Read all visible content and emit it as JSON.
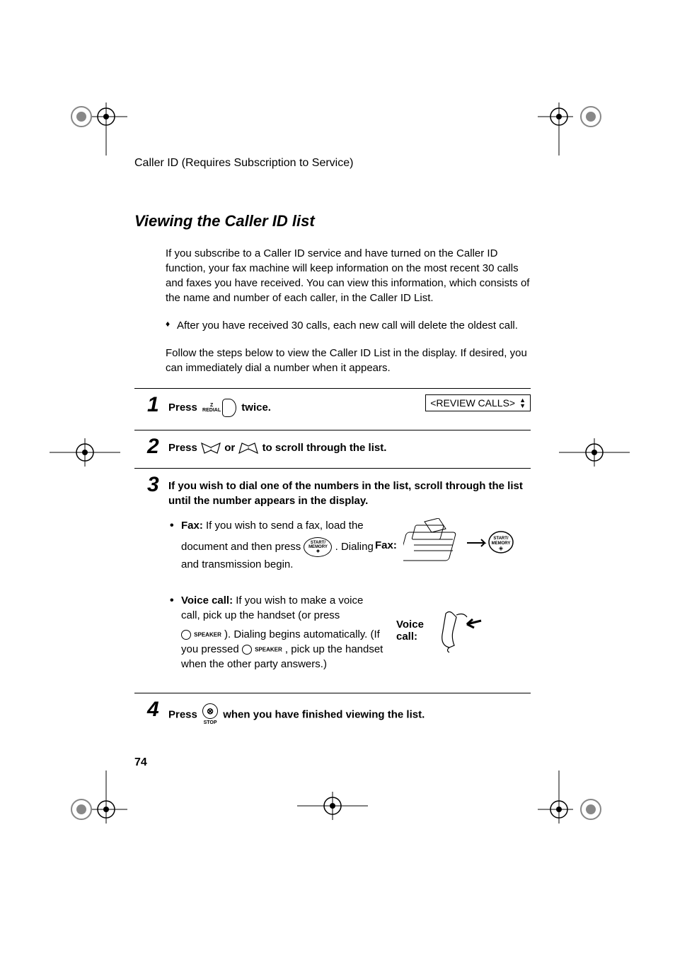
{
  "header": "Caller ID (Requires Subscription to Service)",
  "section_title": "Viewing the Caller ID list",
  "intro": "If you subscribe to a Caller ID service and have turned on the Caller ID function, your fax machine will keep information on the most recent 30 calls and faxes you have received. You can view this information, which consists of the name and number of each caller, in the Caller ID List.",
  "bullet": "After you have received 30 calls, each new call will delete the oldest call.",
  "follow": "Follow the steps below to view the Caller ID List in the display. If desired, you can immediately dial a number when it appears.",
  "display_text": "<REVIEW CALLS>",
  "steps": {
    "s1": {
      "num": "1",
      "press": "Press",
      "twice": " twice."
    },
    "s2": {
      "num": "2",
      "press": "Press ",
      "or": " or ",
      "tail": "  to  scroll through the list."
    },
    "s3": {
      "num": "3",
      "head": "If you wish to dial one of the numbers in the list, scroll through the list until the number appears in the display.",
      "fax_label": "Fax:",
      "fax_text1": " If you wish to send a fax, load the",
      "fax_text2": "document and then press ",
      "fax_text3": ". Dialing and transmission begin.",
      "voice_label": "Voice call:",
      "voice_text1": " If you wish to make a voice call, pick up the handset (or press",
      "voice_text2": "). Dialing begins automatically. (If you pressed ",
      "voice_text3": ", pick up the handset when the other party answers.)",
      "side_fax": "Fax:",
      "side_voice": "Voice call:"
    },
    "s4": {
      "num": "4",
      "press": "Press ",
      "tail": " when you have finished viewing the list."
    }
  },
  "keys": {
    "redial": "REDIAL",
    "z": "Z",
    "start_memory_1": "START/",
    "start_memory_2": "MEMORY",
    "speaker": "SPEAKER",
    "stop": "STOP"
  },
  "page_number": "74"
}
